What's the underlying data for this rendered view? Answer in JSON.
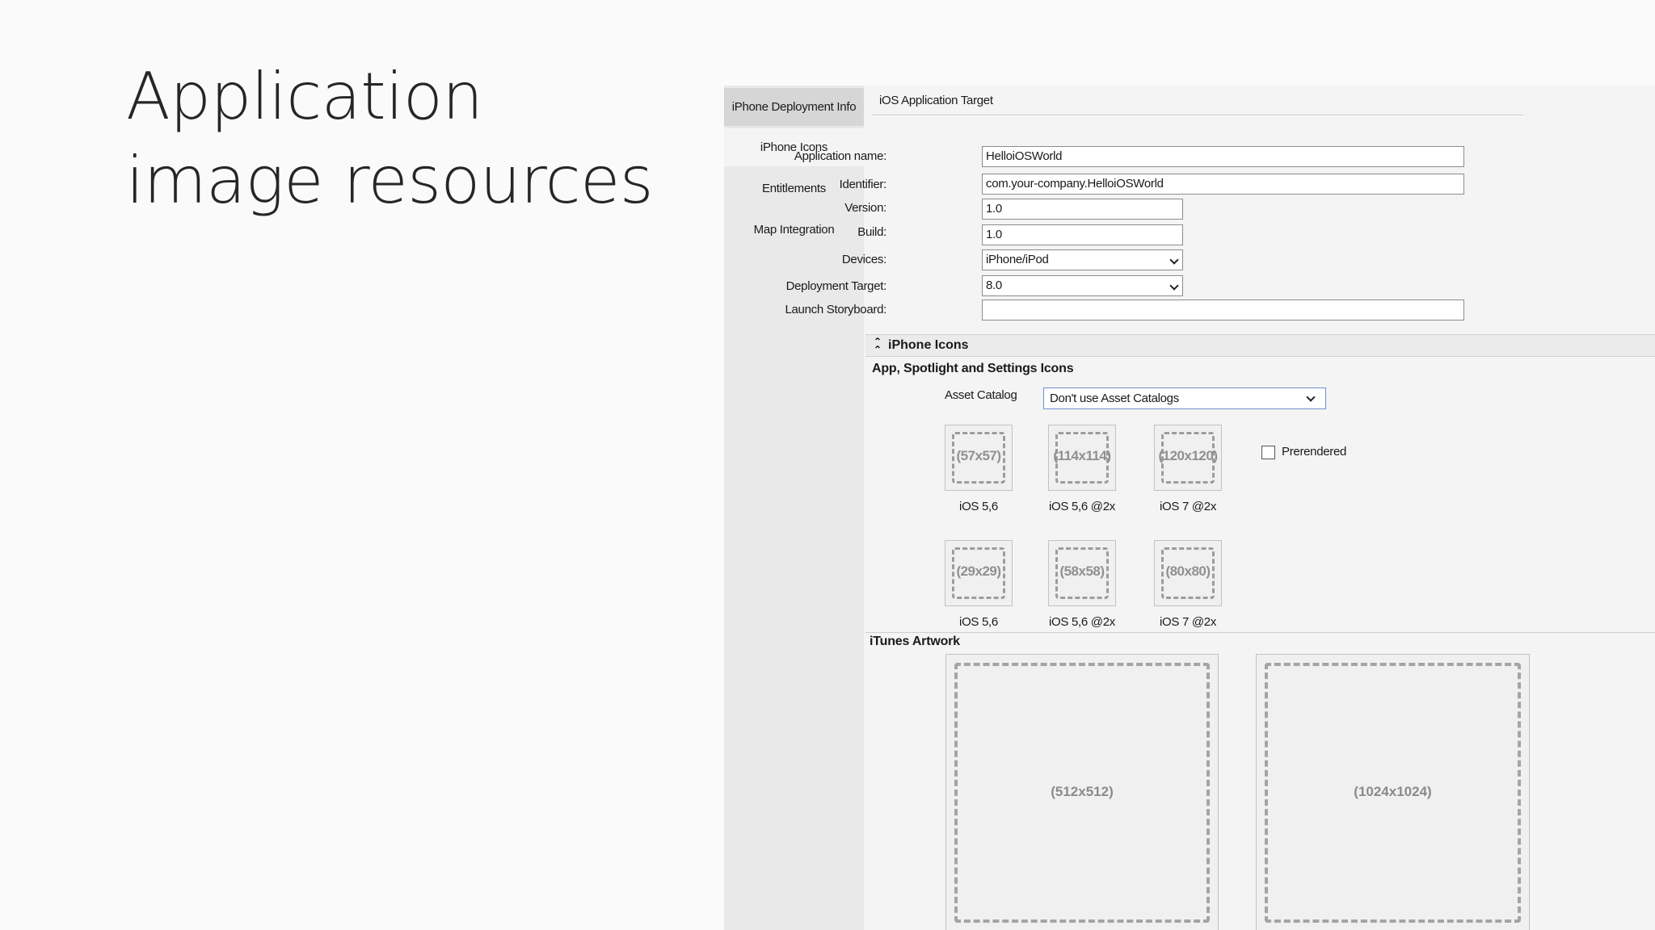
{
  "slide": {
    "title_line1": "Application",
    "title_line2": "image resources"
  },
  "nav": {
    "items": [
      {
        "label": "iPhone Deployment Info"
      },
      {
        "label": "iPhone Icons"
      },
      {
        "label": "Entitlements"
      },
      {
        "label": "Map Integration"
      }
    ],
    "selected": "iPhone Icons"
  },
  "target": {
    "label": "iOS Application Target"
  },
  "form": {
    "app_name_label": "Application name:",
    "app_name_value": "HelloiOSWorld",
    "identifier_label": "Identifier:",
    "identifier_value": "com.your-company.HelloiOSWorld",
    "version_label": "Version:",
    "version_value": "1.0",
    "build_label": "Build:",
    "build_value": "1.0",
    "devices_label": "Devices:",
    "devices_value": "iPhone/iPod",
    "deployment_label": "Deployment Target:",
    "deployment_value": "8.0",
    "storyboard_label": "Launch Storyboard:",
    "storyboard_value": ""
  },
  "icons_section": {
    "header": "iPhone Icons",
    "subheader": "App, Spotlight and Settings Icons",
    "asset_catalog_label": "Asset Catalog",
    "asset_catalog_value": "Don't use Asset Catalogs",
    "prerendered_label": "Prerendered",
    "prerendered_checked": false,
    "slots": [
      {
        "size": "(57x57)",
        "caption": "iOS 5,6"
      },
      {
        "size": "(114x114)",
        "caption": "iOS 5,6 @2x"
      },
      {
        "size": "(120x120)",
        "caption": "iOS 7 @2x"
      },
      {
        "size": "(29x29)",
        "caption": "iOS 5,6"
      },
      {
        "size": "(58x58)",
        "caption": "iOS 5,6 @2x"
      },
      {
        "size": "(80x80)",
        "caption": "iOS 7 @2x"
      }
    ]
  },
  "itunes": {
    "header": "iTunes Artwork",
    "slots": [
      {
        "size": "(512x512)"
      },
      {
        "size": "(1024x1024)"
      }
    ]
  },
  "colors": {
    "nav_bg": "#e9e9e9",
    "panel_bg": "#f4f4f4",
    "select_focus_border": "#6f8fcf"
  }
}
